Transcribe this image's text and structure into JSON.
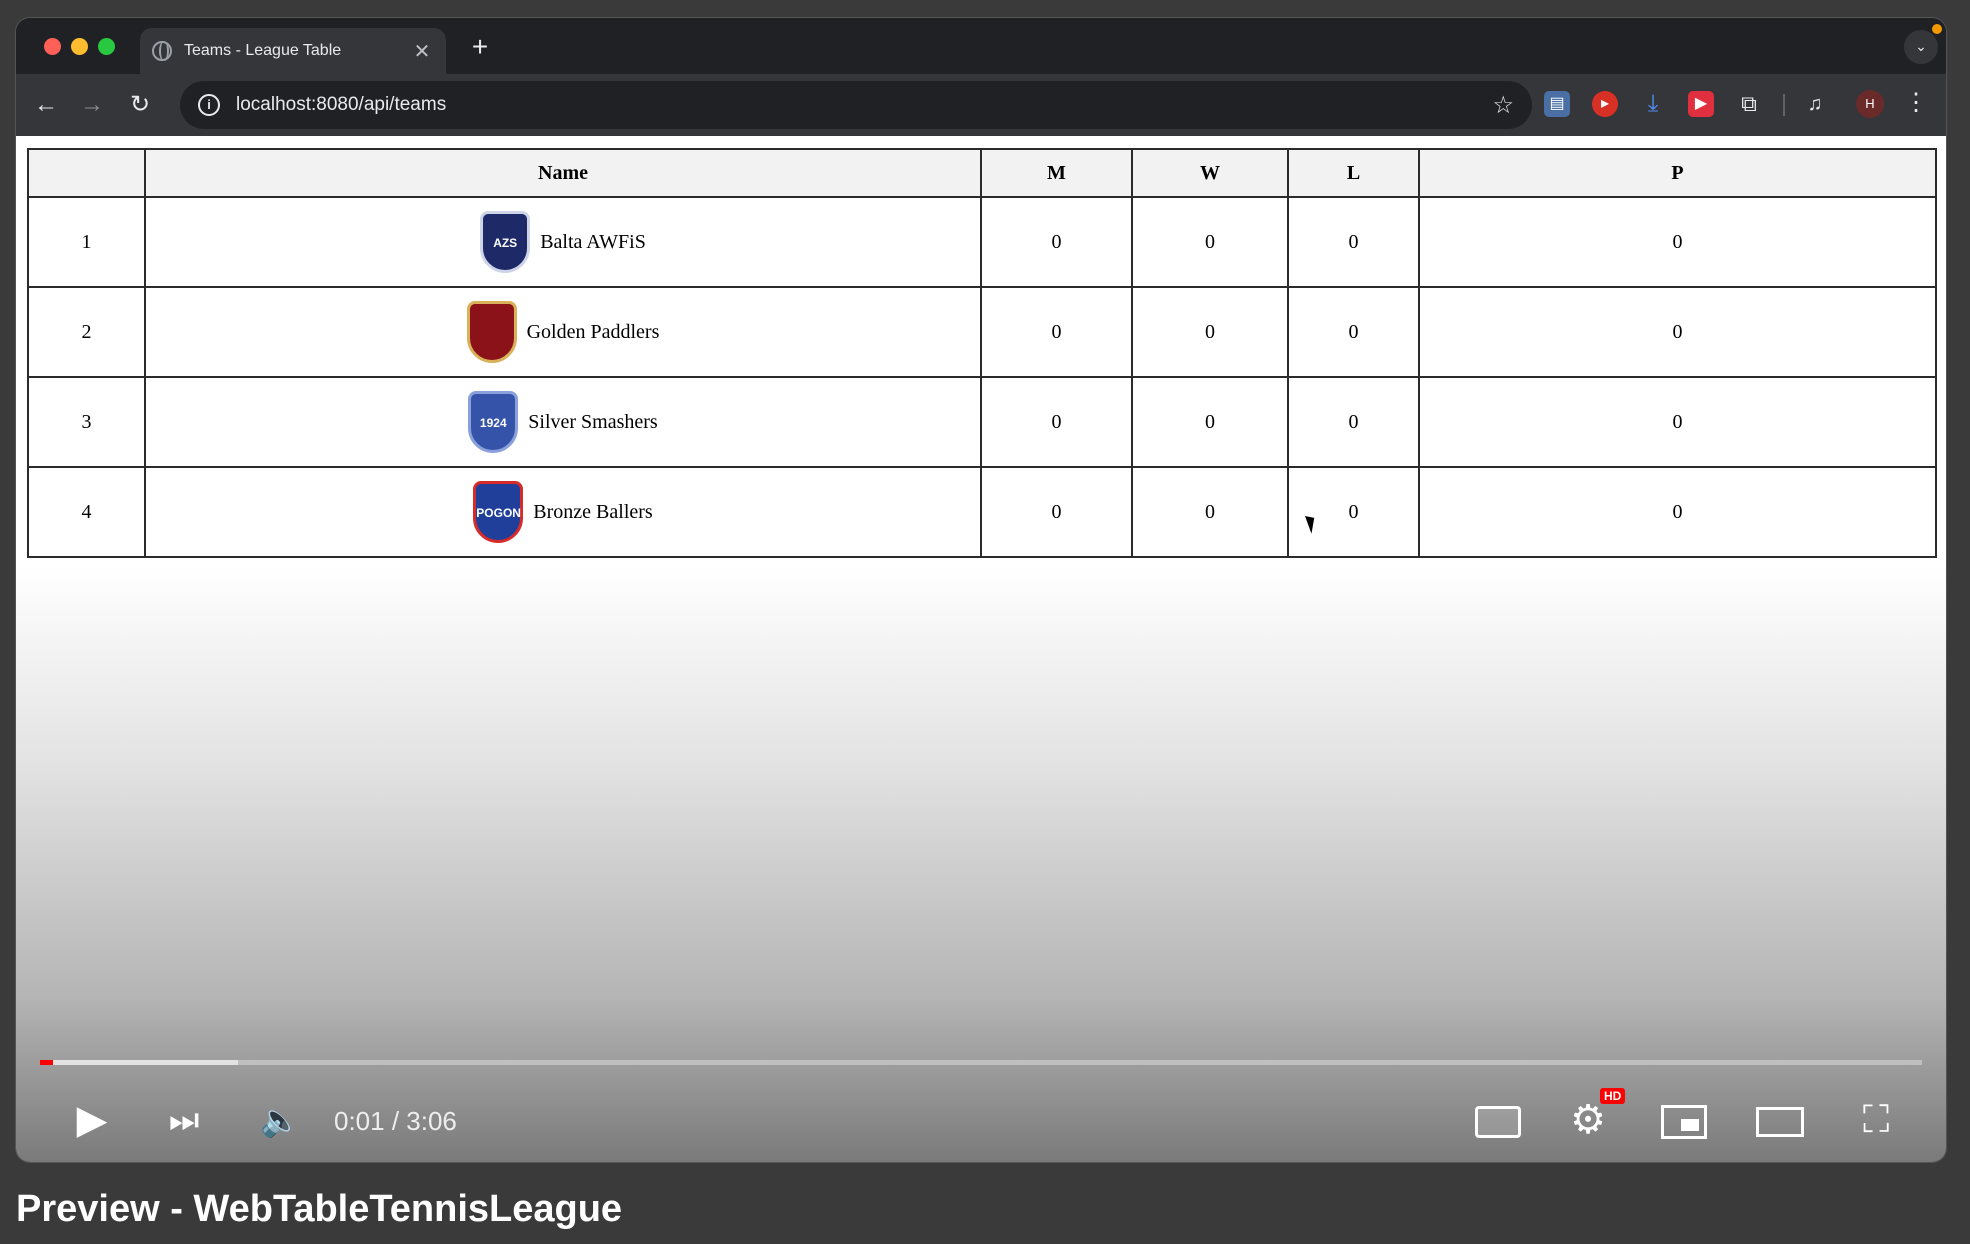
{
  "browser": {
    "tab": {
      "title": "Teams - League Table",
      "close": "✕"
    },
    "new_tab": "+",
    "nav": {
      "back": "←",
      "forward": "→",
      "reload": "↻"
    },
    "address": {
      "url": "localhost:8080/api/teams",
      "info": "i",
      "star": "☆"
    },
    "profile_initial": "H"
  },
  "table": {
    "headers": [
      "",
      "Name",
      "M",
      "W",
      "L",
      "P"
    ],
    "rows": [
      {
        "pos": "1",
        "name": "Balta AWFiS",
        "crest": "AZS",
        "m": "0",
        "w": "0",
        "l": "0",
        "p": "0"
      },
      {
        "pos": "2",
        "name": "Golden Paddlers",
        "crest": "",
        "m": "0",
        "w": "0",
        "l": "0",
        "p": "0"
      },
      {
        "pos": "3",
        "name": "Silver Smashers",
        "crest": "1924",
        "m": "0",
        "w": "0",
        "l": "0",
        "p": "0"
      },
      {
        "pos": "4",
        "name": "Bronze Ballers",
        "crest": "POGON",
        "m": "0",
        "w": "0",
        "l": "0",
        "p": "0"
      }
    ]
  },
  "player": {
    "time": "0:01 / 3:06",
    "played_fraction": 0.007,
    "loaded_fraction": 0.105,
    "hd_badge": "HD",
    "accent_color": "#ff0000"
  },
  "caption": "Preview - WebTableTennisLeague"
}
